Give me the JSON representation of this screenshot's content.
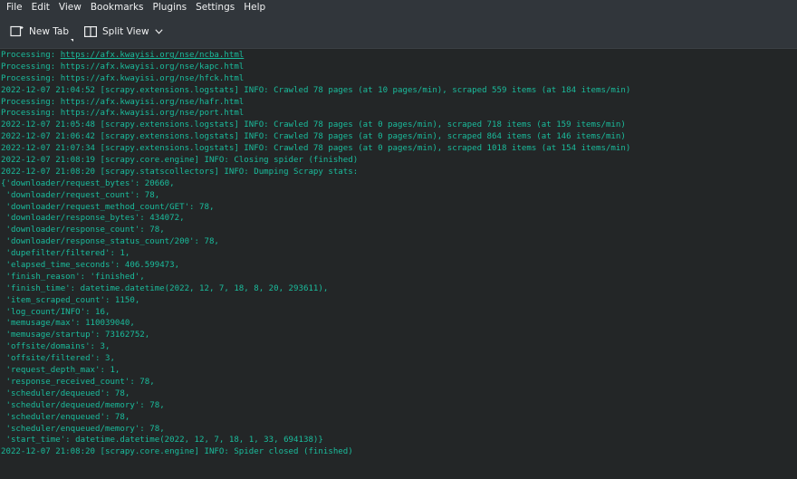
{
  "menubar": {
    "items": [
      "File",
      "Edit",
      "View",
      "Bookmarks",
      "Plugins",
      "Settings",
      "Help"
    ]
  },
  "toolbar": {
    "new_tab_label": "New Tab",
    "split_view_label": "Split View"
  },
  "colors": {
    "terminal_text": "#1abc9c",
    "terminal_bg": "#232627",
    "chrome_bg": "#31363b"
  },
  "terminal": {
    "lines": [
      {
        "prefix": "Processing: ",
        "link": "https://afx.kwayisi.org/nse/ncba.html"
      },
      {
        "text": "Processing: https://afx.kwayisi.org/nse/kapc.html"
      },
      {
        "text": "Processing: https://afx.kwayisi.org/nse/hfck.html"
      },
      {
        "text": "2022-12-07 21:04:52 [scrapy.extensions.logstats] INFO: Crawled 78 pages (at 10 pages/min), scraped 559 items (at 184 items/min)"
      },
      {
        "text": "Processing: https://afx.kwayisi.org/nse/hafr.html"
      },
      {
        "text": "Processing: https://afx.kwayisi.org/nse/port.html"
      },
      {
        "text": "2022-12-07 21:05:48 [scrapy.extensions.logstats] INFO: Crawled 78 pages (at 0 pages/min), scraped 718 items (at 159 items/min)"
      },
      {
        "text": "2022-12-07 21:06:42 [scrapy.extensions.logstats] INFO: Crawled 78 pages (at 0 pages/min), scraped 864 items (at 146 items/min)"
      },
      {
        "text": "2022-12-07 21:07:34 [scrapy.extensions.logstats] INFO: Crawled 78 pages (at 0 pages/min), scraped 1018 items (at 154 items/min)"
      },
      {
        "text": "2022-12-07 21:08:19 [scrapy.core.engine] INFO: Closing spider (finished)"
      },
      {
        "text": "2022-12-07 21:08:20 [scrapy.statscollectors] INFO: Dumping Scrapy stats:"
      },
      {
        "text": "{'downloader/request_bytes': 20660,"
      },
      {
        "text": " 'downloader/request_count': 78,"
      },
      {
        "text": " 'downloader/request_method_count/GET': 78,"
      },
      {
        "text": " 'downloader/response_bytes': 434072,"
      },
      {
        "text": " 'downloader/response_count': 78,"
      },
      {
        "text": " 'downloader/response_status_count/200': 78,"
      },
      {
        "text": " 'dupefilter/filtered': 1,"
      },
      {
        "text": " 'elapsed_time_seconds': 406.599473,"
      },
      {
        "text": " 'finish_reason': 'finished',"
      },
      {
        "text": " 'finish_time': datetime.datetime(2022, 12, 7, 18, 8, 20, 293611),"
      },
      {
        "text": " 'item_scraped_count': 1150,"
      },
      {
        "text": " 'log_count/INFO': 16,"
      },
      {
        "text": " 'memusage/max': 110039040,"
      },
      {
        "text": " 'memusage/startup': 73162752,"
      },
      {
        "text": " 'offsite/domains': 3,"
      },
      {
        "text": " 'offsite/filtered': 3,"
      },
      {
        "text": " 'request_depth_max': 1,"
      },
      {
        "text": " 'response_received_count': 78,"
      },
      {
        "text": " 'scheduler/dequeued': 78,"
      },
      {
        "text": " 'scheduler/dequeued/memory': 78,"
      },
      {
        "text": " 'scheduler/enqueued': 78,"
      },
      {
        "text": " 'scheduler/enqueued/memory': 78,"
      },
      {
        "text": " 'start_time': datetime.datetime(2022, 12, 7, 18, 1, 33, 694138)}"
      },
      {
        "text": "2022-12-07 21:08:20 [scrapy.core.engine] INFO: Spider closed (finished)"
      }
    ]
  }
}
